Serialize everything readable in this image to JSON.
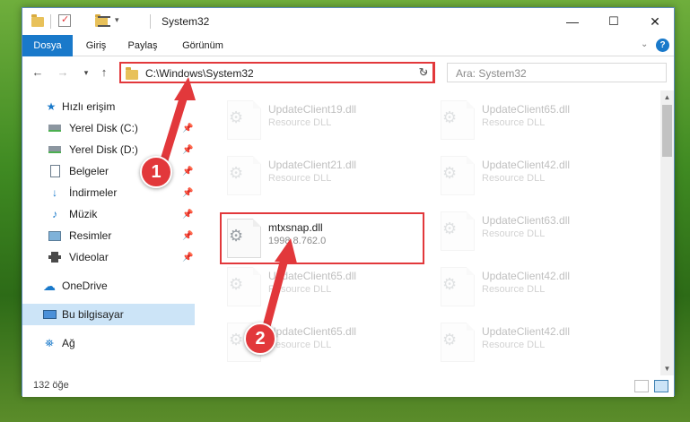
{
  "window": {
    "title": "System32",
    "controls": {
      "minimize": "—",
      "maximize": "☐",
      "close": "✕"
    }
  },
  "ribbon": {
    "tabs": [
      "Dosya",
      "Giriş",
      "Paylaş",
      "Görünüm"
    ],
    "active_tab": "Dosya",
    "expand_icon": "chevron-down",
    "help_label": "?"
  },
  "address_bar": {
    "path": "C:\\Windows\\System32",
    "search_placeholder": "Ara: System32"
  },
  "sidebar": {
    "items": [
      {
        "label": "Hızlı erişim",
        "icon": "star-icon",
        "pinned": false,
        "selected": false
      },
      {
        "label": "Yerel Disk (C:)",
        "icon": "drive-icon",
        "pinned": true,
        "selected": false
      },
      {
        "label": "Yerel Disk (D:)",
        "icon": "drive-icon",
        "pinned": true,
        "selected": false
      },
      {
        "label": "Belgeler",
        "icon": "document-icon",
        "pinned": true,
        "selected": false
      },
      {
        "label": "İndirmeler",
        "icon": "download-icon",
        "pinned": true,
        "selected": false
      },
      {
        "label": "Müzik",
        "icon": "music-icon",
        "pinned": true,
        "selected": false
      },
      {
        "label": "Resimler",
        "icon": "picture-icon",
        "pinned": true,
        "selected": false
      },
      {
        "label": "Videolar",
        "icon": "video-icon",
        "pinned": true,
        "selected": false
      },
      {
        "label": "OneDrive",
        "icon": "cloud-icon",
        "pinned": false,
        "selected": false
      },
      {
        "label": "Bu bilgisayar",
        "icon": "computer-icon",
        "pinned": false,
        "selected": true
      },
      {
        "label": "Ağ",
        "icon": "network-icon",
        "pinned": false,
        "selected": false
      }
    ]
  },
  "files": {
    "left_column": [
      {
        "name": "UpdateClient19.dll",
        "type": "Resource DLL"
      },
      {
        "name": "UpdateClient21.dll",
        "type": "Resource DLL"
      },
      {
        "name": "mtxsnap.dll",
        "type": "1998.8.762.0"
      },
      {
        "name": "UpdateClient65.dll",
        "type": "Resource DLL"
      },
      {
        "name": "UpdateClient65.dll",
        "type": "Resource DLL"
      }
    ],
    "right_column": [
      {
        "name": "UpdateClient65.dll",
        "type": "Resource DLL"
      },
      {
        "name": "UpdateClient42.dll",
        "type": "Resource DLL"
      },
      {
        "name": "UpdateClient63.dll",
        "type": "Resource DLL"
      },
      {
        "name": "UpdateClient42.dll",
        "type": "Resource DLL"
      },
      {
        "name": "UpdateClient42.dll",
        "type": "Resource DLL"
      }
    ]
  },
  "status": {
    "item_count": "132 öğe"
  },
  "callouts": {
    "first": "1",
    "second": "2"
  },
  "colors": {
    "accent": "#1979ca",
    "highlight": "#e2383b",
    "selection": "#cce4f7"
  }
}
